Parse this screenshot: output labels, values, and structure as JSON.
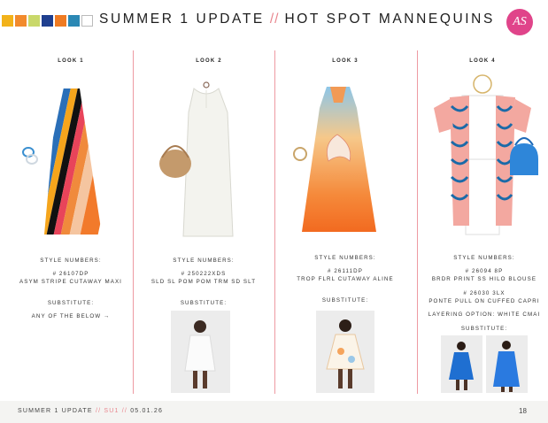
{
  "header": {
    "title_part1": "SUMMER 1 UPDATE",
    "separator": "//",
    "title_part2": "HOT SPOT MANNEQUINS",
    "logo_text": "AS",
    "swatch_colors": [
      "#f2b21a",
      "#f28a2c",
      "#c9d86a",
      "#1f3f8f",
      "#ef7b22",
      "#2b88b4",
      "#ffffff"
    ]
  },
  "looks": [
    {
      "label": "LOOK 1",
      "style_numbers_label": "STYLE NUMBERS:",
      "styles": [
        "# 26107DP",
        "ASYM STRIPE CUTAWAY MAXI"
      ],
      "substitute_label": "SUBSTITUTE:",
      "substitute_text": "ANY OF THE BELOW →"
    },
    {
      "label": "LOOK 2",
      "style_numbers_label": "STYLE NUMBERS:",
      "styles": [
        "# 250222XDS",
        "SLD SL POM POM TRM SD SLT"
      ],
      "substitute_label": "SUBSTITUTE:"
    },
    {
      "label": "LOOK 3",
      "style_numbers_label": "STYLE NUMBERS:",
      "styles": [
        "# 26111DP",
        "TROP FLRL CUTAWAY ALINE"
      ],
      "substitute_label": "SUBSTITUTE:"
    },
    {
      "label": "LOOK 4",
      "style_numbers_label": "STYLE NUMBERS:",
      "styles": [
        "# 26094 8P",
        "BRDR PRINT SS HILO BLOUSE",
        "# 26030 3LX",
        "PONTE PULL ON CUFFED CAPRI"
      ],
      "layering_option": "LAYERING OPTION: WHITE CMAI",
      "substitute_label": "SUBSTITUTE:"
    }
  ],
  "footer": {
    "part1": "SUMMER 1 UPDATE",
    "sep": "//",
    "part2": "SU1",
    "part3": "05.01.26",
    "page": "18"
  }
}
